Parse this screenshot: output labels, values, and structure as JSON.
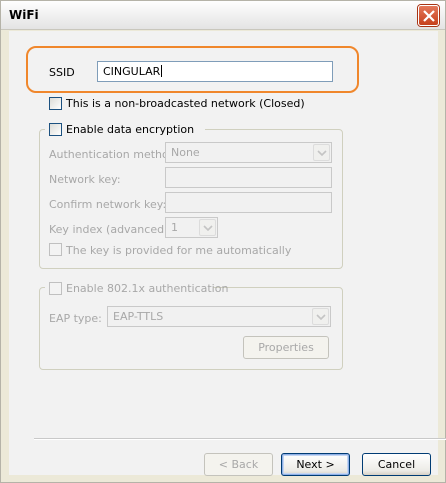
{
  "window": {
    "title": "WiFi"
  },
  "ssid": {
    "label": "SSID",
    "value": "CINGULAR"
  },
  "non_broadcast": {
    "label": "This is a non-broadcasted network (Closed)",
    "checked": false
  },
  "encryption": {
    "label": "Enable data encryption",
    "checked": false,
    "auth_label": "Authentication method:",
    "auth_value": "None",
    "network_key_label": "Network key:",
    "confirm_key_label": "Confirm network key:",
    "key_index_label": "Key index (advanced):",
    "key_index_value": "1",
    "auto_key_label": "The key is provided for me automatically"
  },
  "auth8021x": {
    "label": "Enable 802.1x authentication",
    "eap_label": "EAP type:",
    "eap_value": "EAP-TTLS",
    "properties_label": "Properties"
  },
  "buttons": {
    "back": "< Back",
    "next": "Next >",
    "cancel": "Cancel"
  },
  "icons": {
    "close": "close-icon",
    "dropdown": "chevron-down-icon"
  },
  "colors": {
    "highlight": "#f0872c",
    "close": "#c6401c"
  }
}
